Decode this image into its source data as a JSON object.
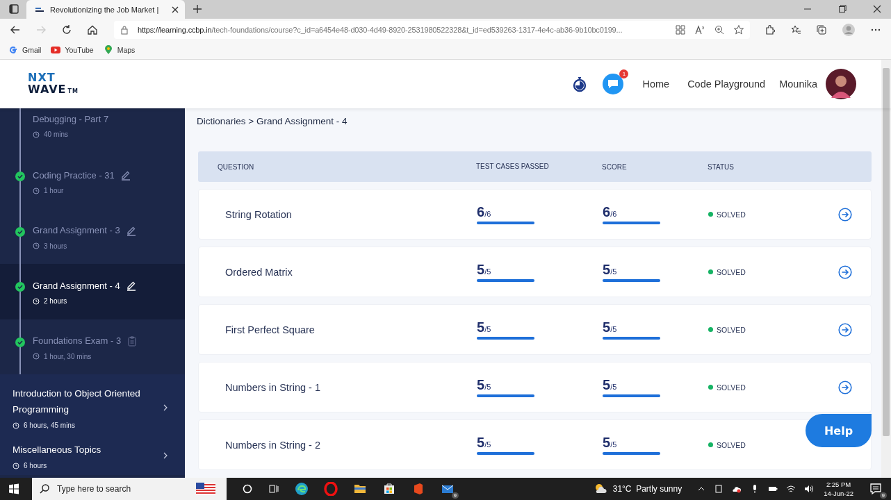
{
  "browser": {
    "tab_title": "Revolutionizing the Job Market |",
    "url_host": "https://learning.ccbp.in",
    "url_path": "/tech-foundations/course?c_id=a6454e48-d030-4d49-8920-2531980522328&t_id=ed539263-1317-4e4c-ab36-9b10bc0199...",
    "bookmarks": [
      {
        "label": "Gmail",
        "kind": "gmail"
      },
      {
        "label": "YouTube",
        "kind": "youtube"
      },
      {
        "label": "Maps",
        "kind": "maps"
      }
    ]
  },
  "header": {
    "logo_top": "NXT",
    "logo_bottom": "WAVE",
    "logo_tm": "TM",
    "notification_count": "1",
    "nav": [
      "Home",
      "Code Playground"
    ],
    "user_name": "Mounika"
  },
  "sidebar": {
    "items": [
      {
        "title": "Debugging - Part 7",
        "duration": "40 mins",
        "selected": false,
        "kind": "none"
      },
      {
        "title": "Coding Practice - 31",
        "duration": "1 hour",
        "completed": true,
        "selected": false,
        "kind": "edit"
      },
      {
        "title": "Grand Assignment - 3",
        "duration": "3 hours",
        "completed": true,
        "selected": false,
        "kind": "edit"
      },
      {
        "title": "Grand Assignment - 4",
        "duration": "2 hours",
        "completed": true,
        "selected": true,
        "kind": "edit"
      },
      {
        "title": "Foundations Exam - 3",
        "duration": "1 hour, 30 mins",
        "completed": true,
        "selected": false,
        "kind": "exam"
      }
    ],
    "sections": [
      {
        "title": "Introduction to Object Oriented Programming",
        "duration": "6 hours, 45 mins"
      },
      {
        "title": "Miscellaneous Topics",
        "duration": "6 hours"
      }
    ]
  },
  "breadcrumb": "Dictionaries > Grand Assignment - 4",
  "table": {
    "columns": [
      "QUESTION",
      "TEST CASES PASSED",
      "SCORE",
      "STATUS"
    ],
    "rows": [
      {
        "question": "String Rotation",
        "passed": "6",
        "total": "/6",
        "passed_bar": {
          "level": 1
        },
        "score": "6",
        "score_total": "/6",
        "score_bar": {
          "level": 1
        },
        "status": "SOLVED",
        "color": "#16b364",
        "open_arrow": true
      },
      {
        "question": "Ordered Matrix",
        "passed": "5",
        "total": "/5",
        "passed_bar": {
          "level": 1
        },
        "score": "5",
        "score_total": "/5",
        "score_bar": {
          "level": 1
        },
        "status": "SOLVED",
        "color": "#16b364",
        "open_arrow": true
      },
      {
        "question": "First Perfect Square",
        "passed": "5",
        "total": "/5",
        "passed_bar": {
          "level": 1
        },
        "score": "5",
        "score_total": "/5",
        "score_bar": {
          "level": 1
        },
        "status": "SOLVED",
        "color": "#16b364",
        "open_arrow": true
      },
      {
        "question": "Numbers in String - 1",
        "passed": "5",
        "total": "/5",
        "passed_bar": {
          "level": 1
        },
        "score": "5",
        "score_total": "/5",
        "score_bar": {
          "level": 1
        },
        "status": "SOLVED",
        "color": "#16b364",
        "open_arrow": true
      },
      {
        "question": "Numbers in String - 2",
        "passed": "5",
        "total": "/5",
        "passed_bar": {
          "level": 1
        },
        "score": "5",
        "score_total": "/5",
        "score_bar": {
          "level": 1
        },
        "status": "SOLVED",
        "color": "#16b364",
        "open_arrow": false
      }
    ]
  },
  "help_button": "Help",
  "taskbar": {
    "search_placeholder": "Type here to search",
    "weather": "31°C  Partly sunny",
    "time": "2:25 PM",
    "date": "14-Jun-22",
    "mail_badge": "9",
    "notification_badge": "9"
  }
}
